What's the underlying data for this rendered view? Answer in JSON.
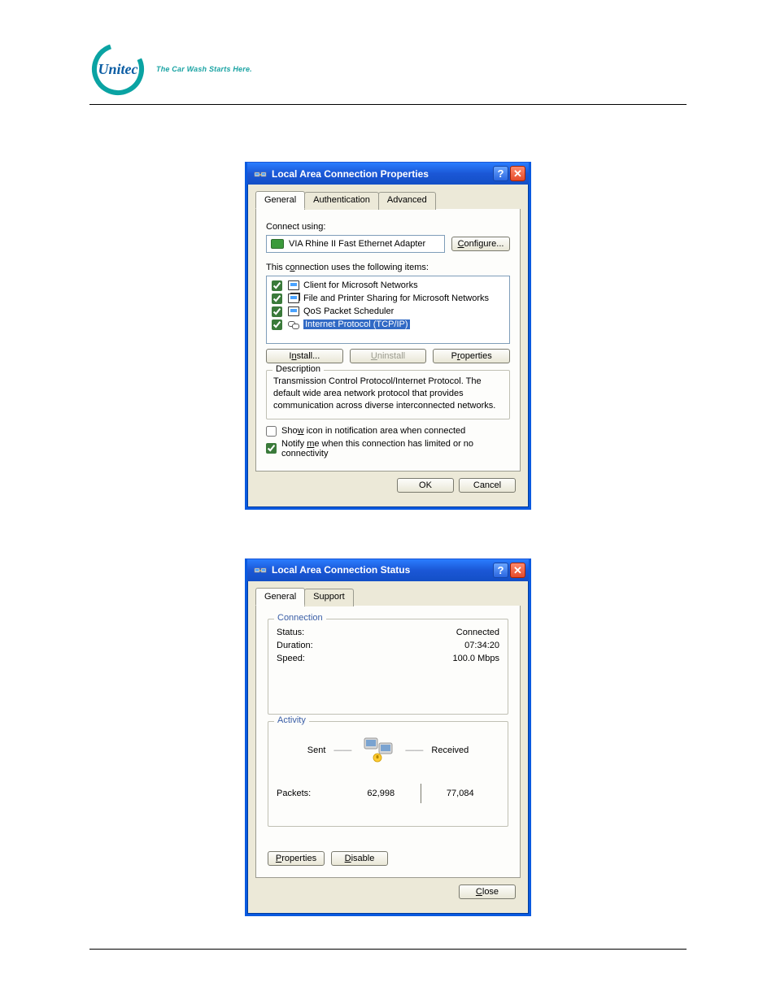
{
  "brand": {
    "name": "Unitec",
    "tagline": "The Car Wash Starts Here."
  },
  "dialog1": {
    "title": "Local Area Connection Properties",
    "tabs": [
      "General",
      "Authentication",
      "Advanced"
    ],
    "connect_using_label": "Connect using:",
    "adapter": "VIA Rhine II Fast Ethernet Adapter",
    "configure_btn": "Configure...",
    "items_label": "This connection uses the following items:",
    "items": [
      {
        "checked": true,
        "label": "Client for Microsoft Networks",
        "selected": false
      },
      {
        "checked": true,
        "label": "File and Printer Sharing for Microsoft Networks",
        "selected": false
      },
      {
        "checked": true,
        "label": "QoS Packet Scheduler",
        "selected": false
      },
      {
        "checked": true,
        "label": "Internet Protocol (TCP/IP)",
        "selected": true
      }
    ],
    "install_btn": "Install...",
    "uninstall_btn": "Uninstall",
    "properties_btn": "Properties",
    "description_legend": "Description",
    "description_text": "Transmission Control Protocol/Internet Protocol. The default wide area network protocol that provides communication across diverse interconnected networks.",
    "show_icon_checked": false,
    "show_icon_label": "Show icon in notification area when connected",
    "notify_checked": true,
    "notify_label": "Notify me when this connection has limited or no connectivity",
    "ok_btn": "OK",
    "cancel_btn": "Cancel"
  },
  "dialog2": {
    "title": "Local Area Connection Status",
    "tabs": [
      "General",
      "Support"
    ],
    "connection_legend": "Connection",
    "status_label": "Status:",
    "status_value": "Connected",
    "duration_label": "Duration:",
    "duration_value": "07:34:20",
    "speed_label": "Speed:",
    "speed_value": "100.0 Mbps",
    "activity_legend": "Activity",
    "sent_label": "Sent",
    "received_label": "Received",
    "packets_label": "Packets:",
    "packets_sent": "62,998",
    "packets_received": "77,084",
    "properties_btn": "Properties",
    "disable_btn": "Disable",
    "close_btn": "Close"
  }
}
